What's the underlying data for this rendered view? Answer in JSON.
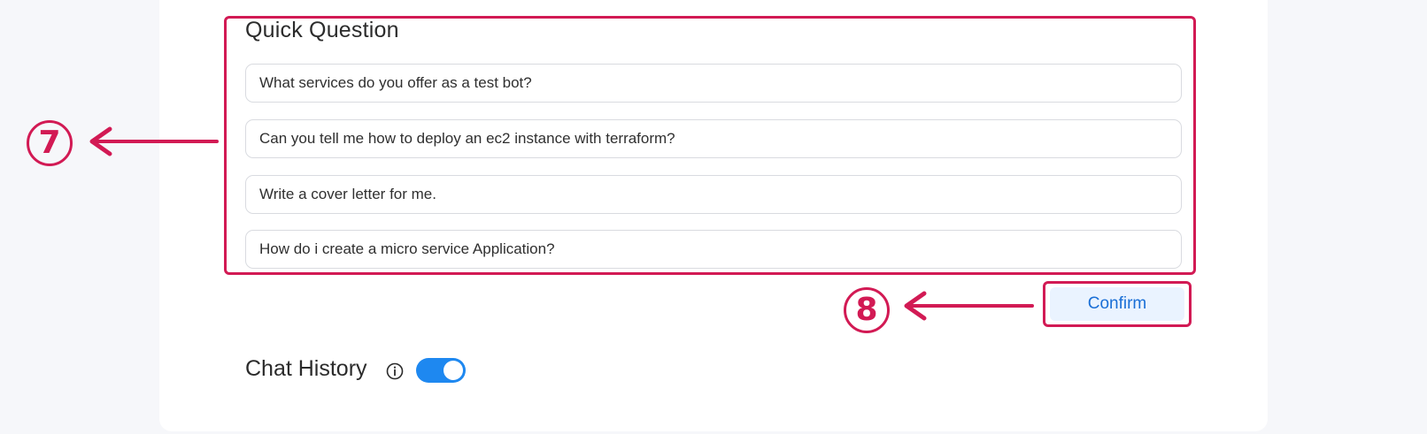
{
  "quick_question": {
    "title": "Quick Question",
    "questions": [
      "What services do you offer as a test bot?",
      "Can you tell me how to deploy an ec2 instance with terraform?",
      "Write a cover letter for me.",
      "How do i create a micro service Application?"
    ]
  },
  "confirm": {
    "label": "Confirm"
  },
  "chat_history": {
    "label": "Chat History",
    "toggle_on": true,
    "info_icon": "info-icon"
  },
  "annotations": {
    "marker_7": "7",
    "marker_8": "8",
    "color": "#d21a54"
  },
  "colors": {
    "accent": "#1e88f0",
    "button_text": "#1a6fd6",
    "button_bg": "#eaf3ff"
  }
}
